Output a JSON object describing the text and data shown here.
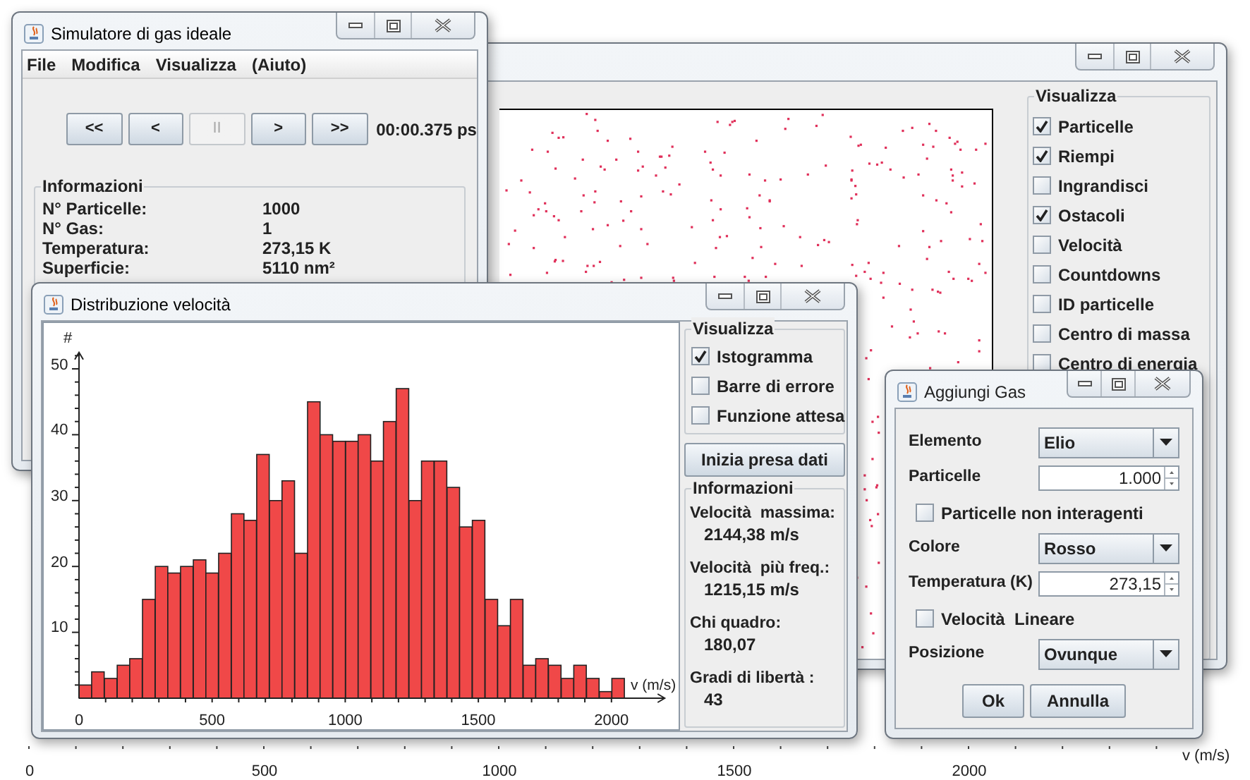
{
  "simulator_window": {
    "title": "Simulatore di gas ideale",
    "menu": [
      "File",
      "Modifica",
      "Visualizza",
      "(Aiuto)"
    ],
    "playback_buttons": [
      {
        "label": "<<",
        "disabled": false
      },
      {
        "label": "<",
        "disabled": false
      },
      {
        "label": "II",
        "disabled": true
      },
      {
        "label": ">",
        "disabled": false
      },
      {
        "label": ">>",
        "disabled": false
      }
    ],
    "time": "00:00.375 ps",
    "info": {
      "title": "Informazioni",
      "rows": [
        {
          "label": "N° Particelle:",
          "value": "1000"
        },
        {
          "label": "N° Gas:",
          "value": "1"
        },
        {
          "label": "Temperatura:",
          "value": "273,15 K"
        },
        {
          "label": "Superficie:",
          "value": "5110 nm²"
        }
      ]
    }
  },
  "view_window": {
    "options_title": "Visualizza",
    "options": [
      {
        "label": "Particelle",
        "checked": true
      },
      {
        "label": "Riempi",
        "checked": true
      },
      {
        "label": "Ingrandisci",
        "checked": false
      },
      {
        "label": "Ostacoli",
        "checked": true
      },
      {
        "label": "Velocità",
        "checked": false
      },
      {
        "label": "Countdowns",
        "checked": false
      },
      {
        "label": "ID particelle",
        "checked": false
      },
      {
        "label": "Centro di massa",
        "checked": false
      },
      {
        "label": "Centro di energia",
        "checked": false
      }
    ]
  },
  "histogram_window": {
    "title": "Distribuzione velocità",
    "chart_data": {
      "type": "bar",
      "xlabel": "v (m/s)",
      "ylabel": "#",
      "x": [
        24,
        71,
        119,
        167,
        214,
        262,
        310,
        357,
        405,
        453,
        500,
        548,
        596,
        643,
        691,
        739,
        786,
        834,
        882,
        929,
        977,
        1025,
        1072,
        1120,
        1167,
        1215,
        1263,
        1310,
        1358,
        1406,
        1453,
        1501,
        1549,
        1596,
        1644,
        1692,
        1739,
        1787,
        1835,
        1882,
        1930,
        1978,
        2025
      ],
      "values": [
        2,
        4,
        3,
        5,
        6,
        15,
        20,
        19,
        20,
        21,
        19,
        22,
        28,
        27,
        37,
        30,
        33,
        22,
        45,
        40,
        39,
        39,
        40,
        36,
        42,
        47,
        30,
        36,
        36,
        32,
        26,
        27,
        15,
        11,
        15,
        5,
        6,
        5,
        3,
        5,
        3,
        1,
        3
      ],
      "xlim": [
        0,
        2200
      ],
      "ylim": [
        0,
        52.5
      ],
      "xticks": [
        0,
        500,
        1000,
        1500,
        2000
      ],
      "yticks": [
        10,
        20,
        30,
        40,
        50
      ]
    },
    "options_title": "Visualizza",
    "options": [
      {
        "label": "Istogramma",
        "checked": true
      },
      {
        "label": "Barre di errore",
        "checked": false
      },
      {
        "label": "Funzione attesa",
        "checked": false
      }
    ],
    "start_button": "Inizia presa dati",
    "info": {
      "title": "Informazioni",
      "rows": [
        {
          "label": "Velocità  massima:",
          "value": "2144,38 m/s"
        },
        {
          "label": "Velocità  più freq.:",
          "value": "1215,15 m/s"
        },
        {
          "label": "Chi quadro:",
          "value": "180,07"
        },
        {
          "label": "Gradi di libertà :",
          "value": "43"
        }
      ]
    }
  },
  "add_gas_dialog": {
    "title": "Aggiungi Gas",
    "fields": [
      {
        "kind": "combo",
        "label": "Elemento",
        "value": "Elio"
      },
      {
        "kind": "spinner",
        "label": "Particelle",
        "value": "1.000"
      },
      {
        "kind": "checkbox",
        "label": "Particelle non interagenti",
        "checked": false
      },
      {
        "kind": "combo",
        "label": "Colore",
        "value": "Rosso"
      },
      {
        "kind": "spinner",
        "label": "Temperatura (K)",
        "value": "273,15"
      },
      {
        "kind": "checkbox",
        "label": "Velocità  Lineare",
        "checked": false
      },
      {
        "kind": "combo",
        "label": "Posizione",
        "value": "Ovunque"
      }
    ],
    "buttons": [
      "Ok",
      "Annulla"
    ]
  },
  "background_axis": {
    "ticks": [
      "0",
      "500",
      "1000",
      "1500",
      "2000"
    ],
    "label": "v (m/s)"
  }
}
